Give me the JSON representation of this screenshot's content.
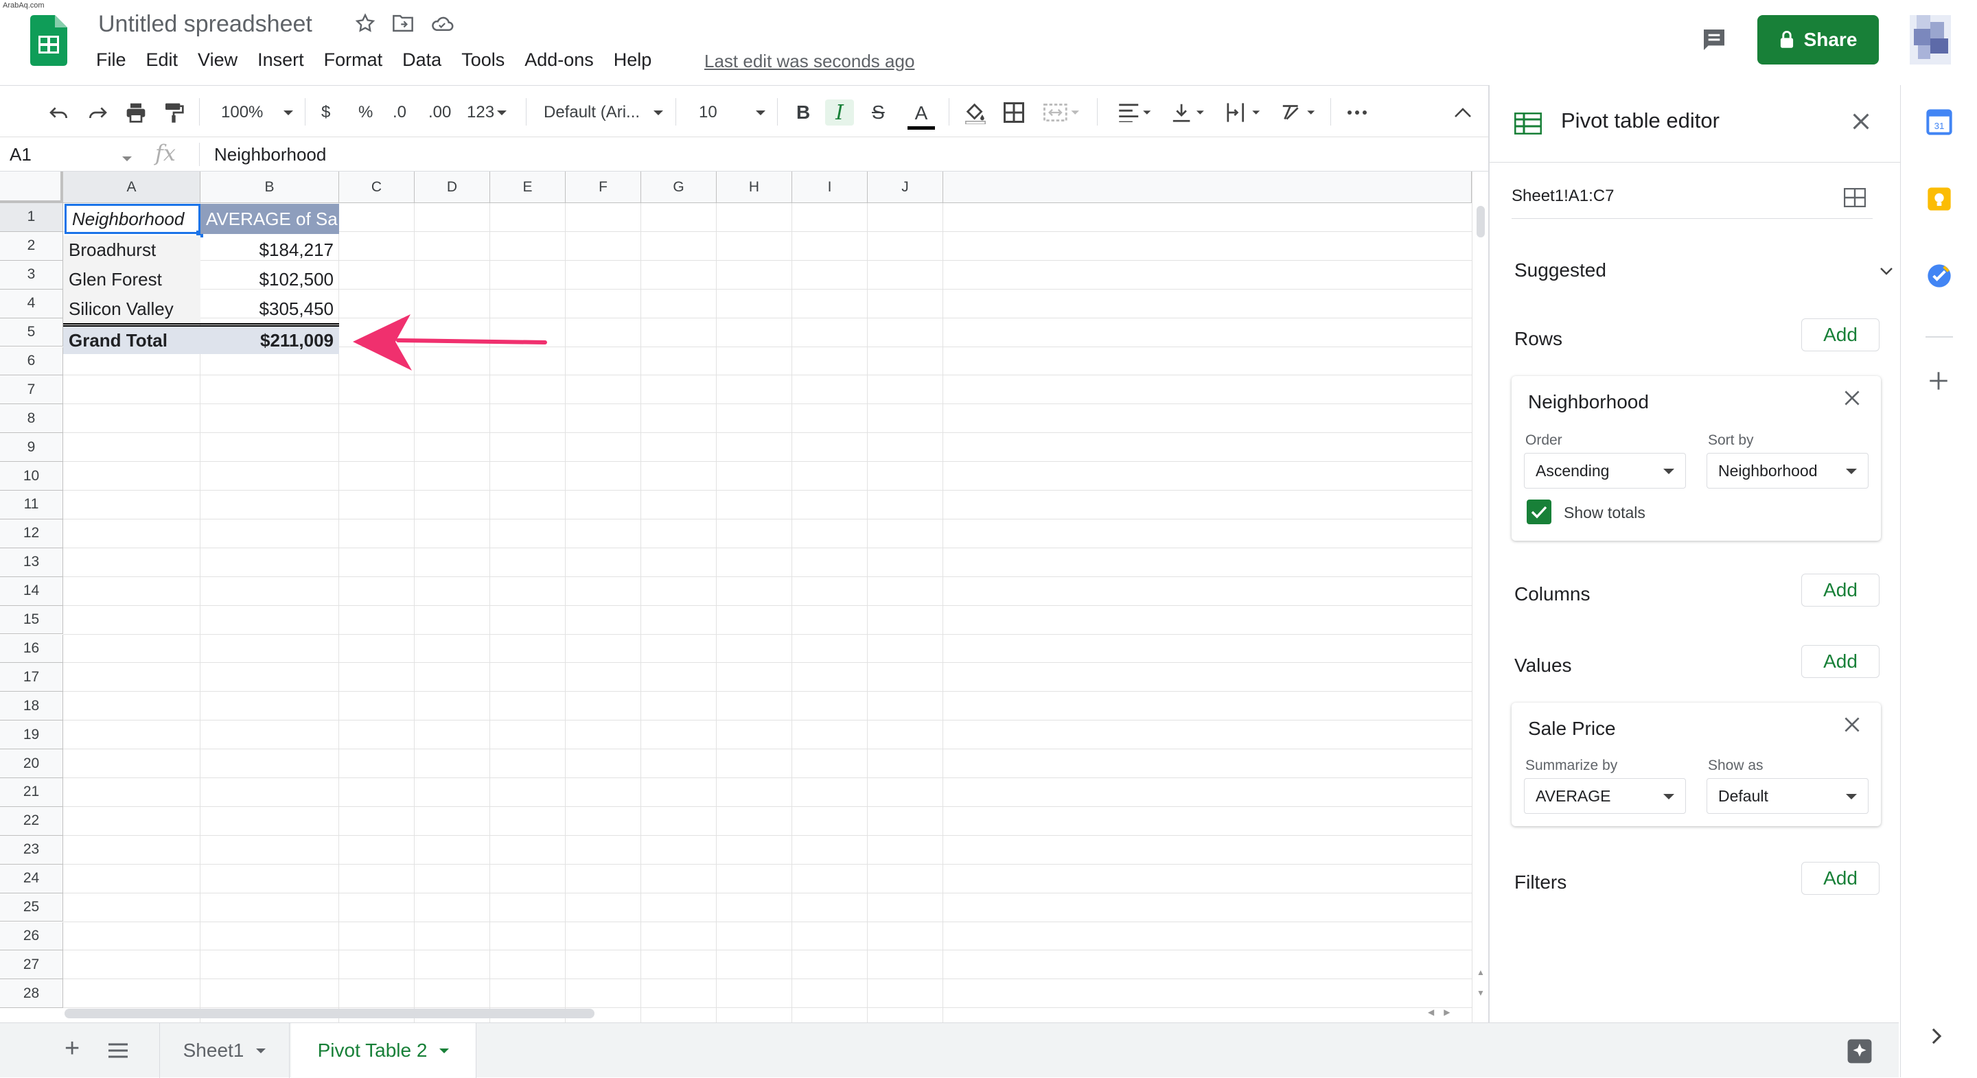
{
  "watermark": "ArabAq.com",
  "header": {
    "doc_title": "Untitled spreadsheet",
    "menus": [
      "File",
      "Edit",
      "View",
      "Insert",
      "Format",
      "Data",
      "Tools",
      "Add-ons",
      "Help"
    ],
    "last_edit": "Last edit was seconds ago",
    "share_label": "Share"
  },
  "toolbar": {
    "zoom": "100%",
    "currency": "$",
    "percent": "%",
    "dec_decrease": ".0",
    "dec_increase": ".00",
    "more_formats": "123",
    "font": "Default (Ari...",
    "font_size": "10",
    "bold": "B",
    "italic": "I",
    "strike": "S",
    "text_color": "A"
  },
  "formula_bar": {
    "cell_ref": "A1",
    "fx": "fx",
    "content": "Neighborhood"
  },
  "grid": {
    "columns": [
      "A",
      "B",
      "C",
      "D",
      "E",
      "F",
      "G",
      "H",
      "I",
      "J"
    ],
    "rows": [
      "1",
      "2",
      "3",
      "4",
      "5",
      "6",
      "7",
      "8",
      "9",
      "10",
      "11",
      "12",
      "13",
      "14",
      "15",
      "16",
      "17",
      "18",
      "19",
      "20",
      "21",
      "22",
      "23",
      "24",
      "25",
      "26",
      "27",
      "28"
    ],
    "pivot": {
      "header_a": "Neighborhood",
      "header_b": "AVERAGE of Sa",
      "data": [
        {
          "name": "Broadhurst",
          "value": "$184,217"
        },
        {
          "name": "Glen Forest",
          "value": "$102,500"
        },
        {
          "name": "Silicon Valley",
          "value": "$305,450"
        }
      ],
      "total_label": "Grand Total",
      "total_value": "$211,009"
    },
    "annotation_color": "#f0306e"
  },
  "sheets": {
    "tabs": [
      "Sheet1",
      "Pivot Table 2"
    ],
    "active": "Pivot Table 2"
  },
  "pivot_editor": {
    "title": "Pivot table editor",
    "range": "Sheet1!A1:C7",
    "suggested": "Suggested",
    "rows_label": "Rows",
    "columns_label": "Columns",
    "values_label": "Values",
    "filters_label": "Filters",
    "add_label": "Add",
    "row_card": {
      "title": "Neighborhood",
      "order_label": "Order",
      "order_value": "Ascending",
      "sortby_label": "Sort by",
      "sortby_value": "Neighborhood",
      "show_totals": "Show totals"
    },
    "value_card": {
      "title": "Sale Price",
      "summarize_label": "Summarize by",
      "summarize_value": "AVERAGE",
      "showas_label": "Show as",
      "showas_value": "Default"
    }
  },
  "colors": {
    "brand_green": "#188038",
    "pivot_header": "#8e9ebd",
    "selection_blue": "#1a73e8"
  }
}
